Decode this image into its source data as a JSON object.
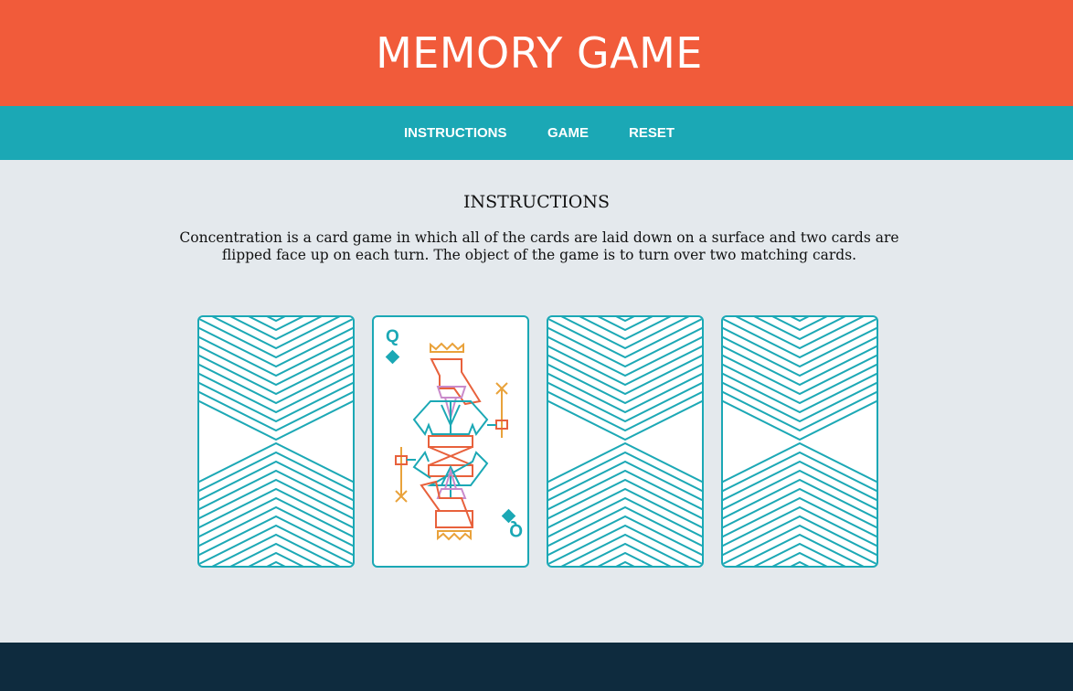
{
  "header": {
    "title": "MEMORY GAME"
  },
  "nav": {
    "items": [
      {
        "label": "INSTRUCTIONS"
      },
      {
        "label": "GAME"
      },
      {
        "label": "RESET"
      }
    ]
  },
  "instructions": {
    "heading": "INSTRUCTIONS",
    "text": "Concentration is a card game in which all of the cards are laid down on a surface and two cards are flipped face up on each turn. The object of the game is to turn over two matching cards."
  },
  "cards": [
    {
      "state": "face-down"
    },
    {
      "state": "face-up",
      "rank": "Q",
      "suit": "diamonds",
      "rank_bottom": "Q"
    },
    {
      "state": "face-down"
    },
    {
      "state": "face-down"
    }
  ],
  "colors": {
    "header": "#f15b3a",
    "nav": "#1ba8b5",
    "background": "#e4e9ed",
    "footer": "#0e2b3e",
    "card_accent": "#1ba8b5",
    "queen_red": "#e8613c",
    "queen_gold": "#e9a23b",
    "queen_pink": "#c98bcb"
  }
}
